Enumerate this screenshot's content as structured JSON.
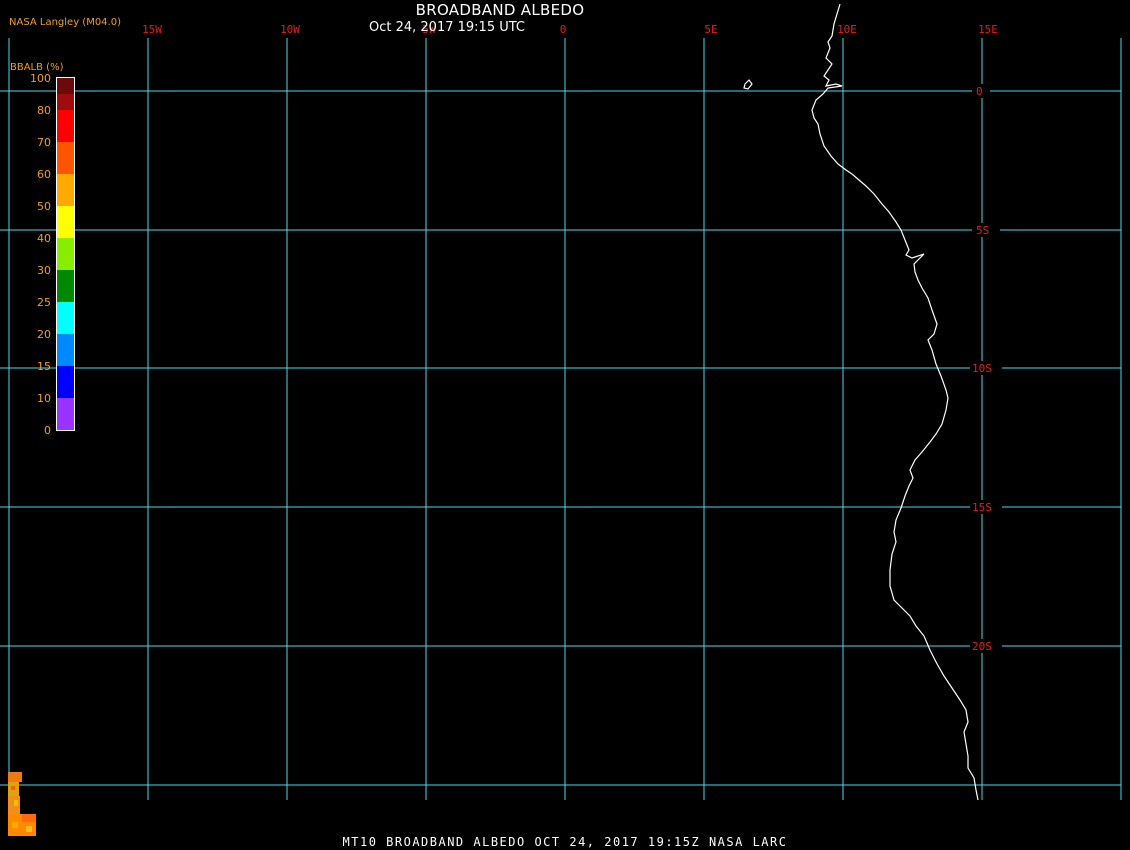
{
  "header": {
    "title": "BROADBAND ALBEDO",
    "subtitle": "Oct 24, 2017 19:15 UTC",
    "credit": "NASA Langley (M04.0)"
  },
  "footer": {
    "text": "MT10  BROADBAND ALBEDO   OCT 24, 2017 19:15Z   NASA LARC"
  },
  "legend": {
    "title": "BBALB (%)",
    "ticks": [
      "100",
      "80",
      "70",
      "60",
      "50",
      "40",
      "30",
      "25",
      "20",
      "15",
      "10",
      "0"
    ],
    "colors": [
      "#6b0a0a",
      "#a00c0c",
      "#ff0000",
      "#ff5500",
      "#ffaa00",
      "#ffff00",
      "#88ee00",
      "#008800",
      "#00ffff",
      "#0088ff",
      "#0000ff",
      "#9933ff"
    ]
  },
  "grid": {
    "lon_labels": [
      "15W",
      "10W",
      "5W",
      "0",
      "5E",
      "10E",
      "15E"
    ],
    "lat_labels": [
      "0",
      "5S",
      "10S",
      "15S",
      "20S"
    ],
    "line_color": "#4fd7e6"
  },
  "map": {
    "coastline_color": "#ffffff",
    "speckle_color": "#f0a020"
  }
}
